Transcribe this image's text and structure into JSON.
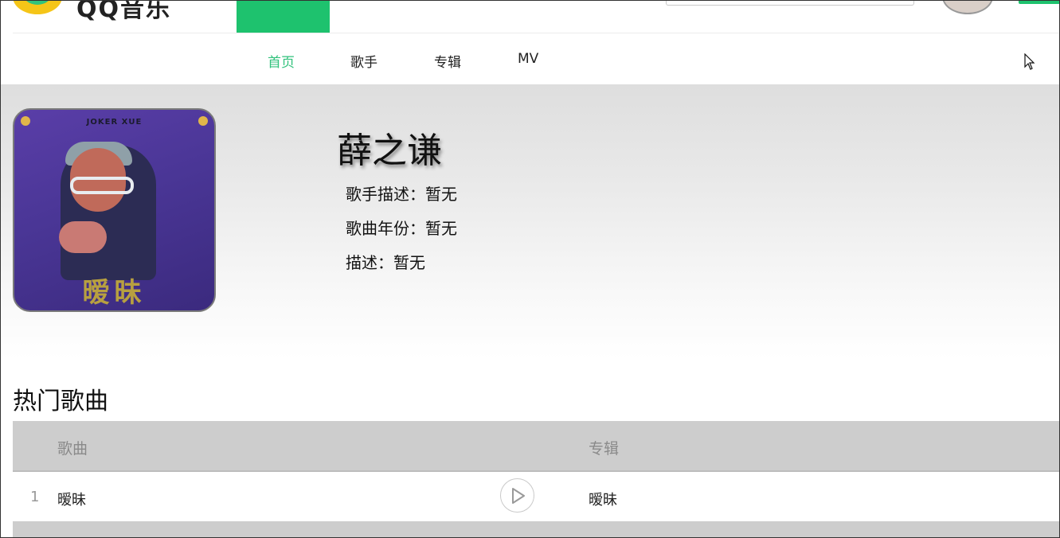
{
  "header": {
    "logo_text": "QQ音乐",
    "logo_icon": "qq-music-logo-icon"
  },
  "nav": {
    "items": [
      {
        "label": "首页",
        "active": true
      },
      {
        "label": "歌手",
        "active": false
      },
      {
        "label": "专辑",
        "active": false
      },
      {
        "label": "MV",
        "active": false
      }
    ]
  },
  "artist": {
    "name": "薛之谦",
    "description": "歌手描述：暂无",
    "year": "歌曲年份：暂无",
    "note": "描述：暂无",
    "cover": {
      "brand_text": "JOKER XUE",
      "album_title": "暧昧"
    }
  },
  "hot_songs": {
    "title": "热门歌曲",
    "columns": [
      "歌曲",
      "专辑"
    ],
    "rows": [
      {
        "index": "1",
        "song": "暧昧",
        "album": "暧昧"
      }
    ]
  },
  "colors": {
    "accent": "#31c27c",
    "brand_green": "#1ec26e",
    "table_header_bg": "#cdcdcd"
  }
}
